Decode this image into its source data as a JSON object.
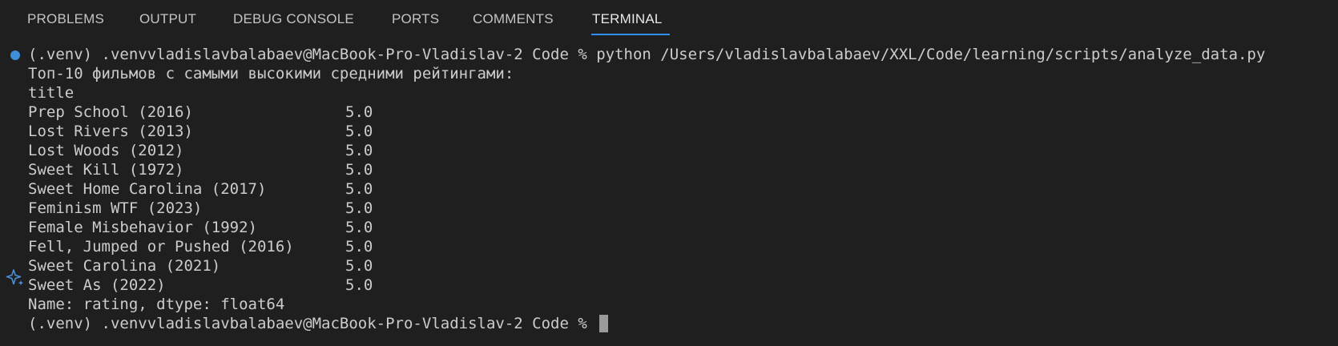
{
  "tabs": [
    {
      "label": "PROBLEMS"
    },
    {
      "label": "OUTPUT"
    },
    {
      "label": "DEBUG CONSOLE"
    },
    {
      "label": "PORTS"
    },
    {
      "label": "COMMENTS"
    },
    {
      "label": "TERMINAL",
      "active": true
    }
  ],
  "terminal": {
    "command_prompt": "(.venv) .venvvladislavbalabaev@MacBook-Pro-Vladislav-2 Code % python /Users/vladislavbalabaev/XXL/Code/learning/scripts/analyze_data.py",
    "header": "Топ-10 фильмов с самыми высокими средними рейтингами:",
    "index_name": "title",
    "rows": [
      {
        "title": "Prep School (2016)",
        "rating": "5.0"
      },
      {
        "title": "Lost Rivers (2013)",
        "rating": "5.0"
      },
      {
        "title": "Lost Woods (2012)",
        "rating": "5.0"
      },
      {
        "title": "Sweet Kill (1972)",
        "rating": "5.0"
      },
      {
        "title": "Sweet Home Carolina (2017)",
        "rating": "5.0"
      },
      {
        "title": "Feminism WTF (2023)",
        "rating": "5.0"
      },
      {
        "title": "Female Misbehavior (1992)",
        "rating": "5.0"
      },
      {
        "title": "Fell, Jumped or Pushed (2016)",
        "rating": "5.0"
      },
      {
        "title": "Sweet Carolina (2021)",
        "rating": "5.0"
      },
      {
        "title": "Sweet As (2022)",
        "rating": "5.0"
      }
    ],
    "footer": "Name: rating, dtype: float64",
    "final_prompt": "(.venv) .venvvladislavbalabaev@MacBook-Pro-Vladislav-2 Code % "
  },
  "colors": {
    "background": "#1f1f1f",
    "text": "#cccccc",
    "accent": "#2f8ffa",
    "command_dot": "#3e8fd8"
  }
}
